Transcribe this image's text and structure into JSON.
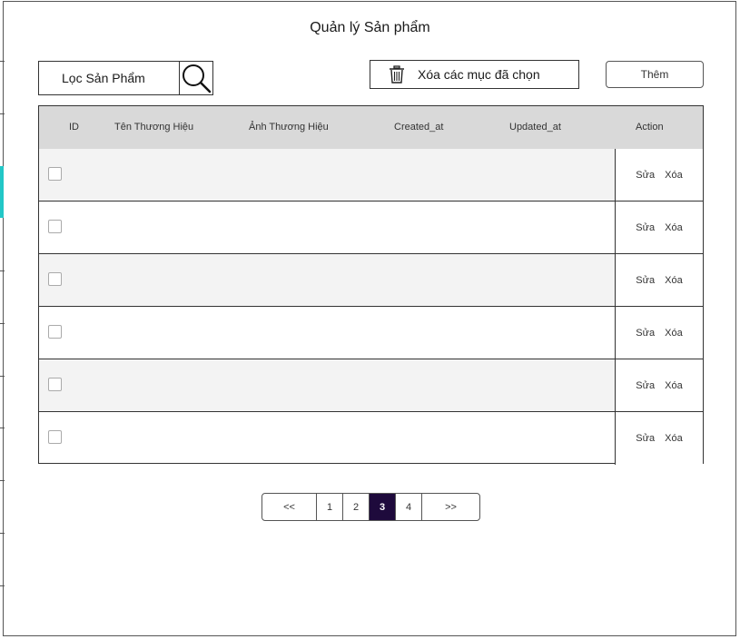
{
  "page": {
    "title": "Quản lý Sản phẩm"
  },
  "toolbar": {
    "filter_label": "Lọc Sản Phẩm",
    "delete_selected_label": "Xóa các mục đã chọn",
    "add_label": "Thêm"
  },
  "table": {
    "columns": [
      "ID",
      "Tên Thương Hiệu",
      "Ảnh Thương Hiệu",
      "Created_at",
      "Updated_at",
      "Action"
    ],
    "rows": [
      {
        "edit": "Sửa",
        "delete": "Xóa"
      },
      {
        "edit": "Sửa",
        "delete": "Xóa"
      },
      {
        "edit": "Sửa",
        "delete": "Xóa"
      },
      {
        "edit": "Sửa",
        "delete": "Xóa"
      },
      {
        "edit": "Sửa",
        "delete": "Xóa"
      },
      {
        "edit": "Sửa",
        "delete": "Xóa"
      }
    ]
  },
  "pagination": {
    "prev": "<<",
    "pages": [
      "1",
      "2",
      "3",
      "4"
    ],
    "current": "3",
    "next": ">>"
  },
  "colors": {
    "header_bg": "#d9d9d9",
    "alt_row_bg": "#f3f3f3",
    "active_page_bg": "#1e0a3c",
    "edge_accent": "#22c7c7"
  }
}
